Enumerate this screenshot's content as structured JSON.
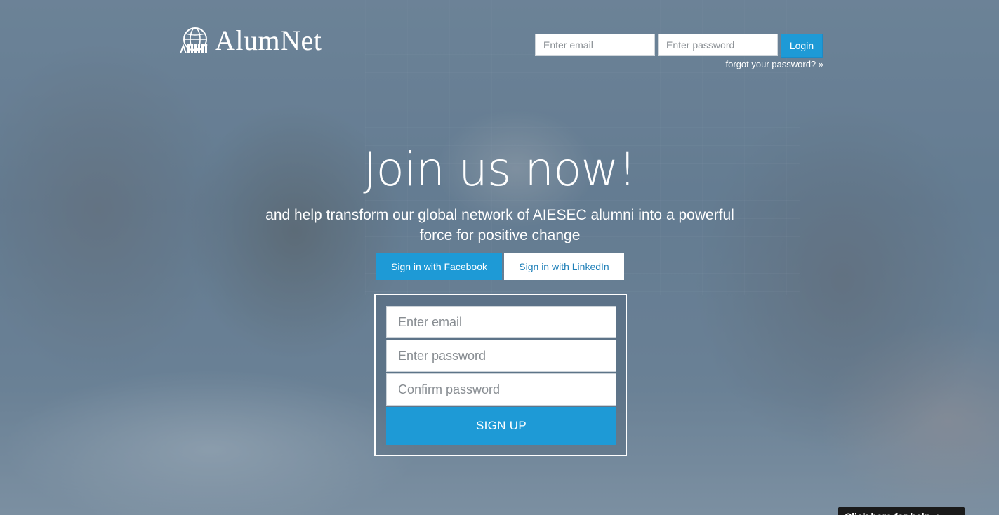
{
  "header": {
    "logo_text": "AlumNet",
    "login": {
      "email_placeholder": "Enter email",
      "password_placeholder": "Enter password",
      "button_label": "Login",
      "forgot_link": "forgot your password? »"
    }
  },
  "hero": {
    "title": "Join us now!",
    "subtitle": "and help transform our global network of AIESEC alumni into a powerful force for positive change"
  },
  "social": {
    "facebook_label": "Sign in with Facebook",
    "linkedin_label": "Sign in with LinkedIn"
  },
  "signup": {
    "email_placeholder": "Enter email",
    "password_placeholder": "Enter password",
    "confirm_placeholder": "Confirm password",
    "button_label": "SIGN UP"
  },
  "help_tab": {
    "label": "Click here for help ▲"
  },
  "colors": {
    "accent": "#1e9ad6",
    "overlay": "#46698a",
    "text_on_dark": "#ffffff"
  },
  "icons": {
    "logo": "alumnet-globe-logo-icon"
  }
}
